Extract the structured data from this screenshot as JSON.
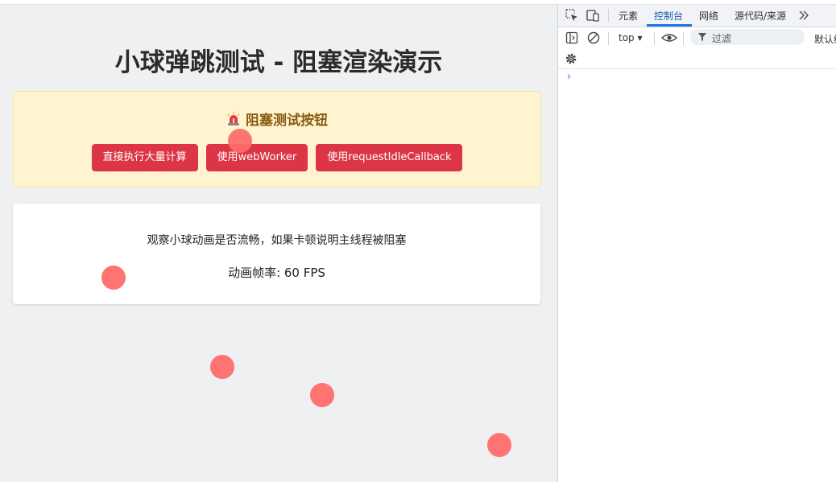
{
  "page": {
    "title": "小球弹跳测试 - 阻塞渲染演示",
    "block_section": {
      "icon": "siren-icon",
      "heading": "阻塞测试按钮",
      "buttons": [
        {
          "label": "直接执行大量计算"
        },
        {
          "label": "使用webWorker"
        },
        {
          "label": "使用requestIdleCallback"
        }
      ]
    },
    "info": {
      "text": "观察小球动画是否流畅，如果卡顿说明主线程被阻塞",
      "fps_label": "动画帧率: 60 FPS"
    },
    "ball_color": "#ff6b6b"
  },
  "devtools": {
    "tabs": [
      {
        "label": "元素"
      },
      {
        "label": "控制台",
        "active": true
      },
      {
        "label": "网络"
      },
      {
        "label": "源代码/来源"
      }
    ],
    "more_tabs_icon": "chevron-double-right-icon",
    "context": "top",
    "filter_placeholder": "过滤",
    "levels_label": "默认级",
    "accent": "#1a73e8"
  }
}
